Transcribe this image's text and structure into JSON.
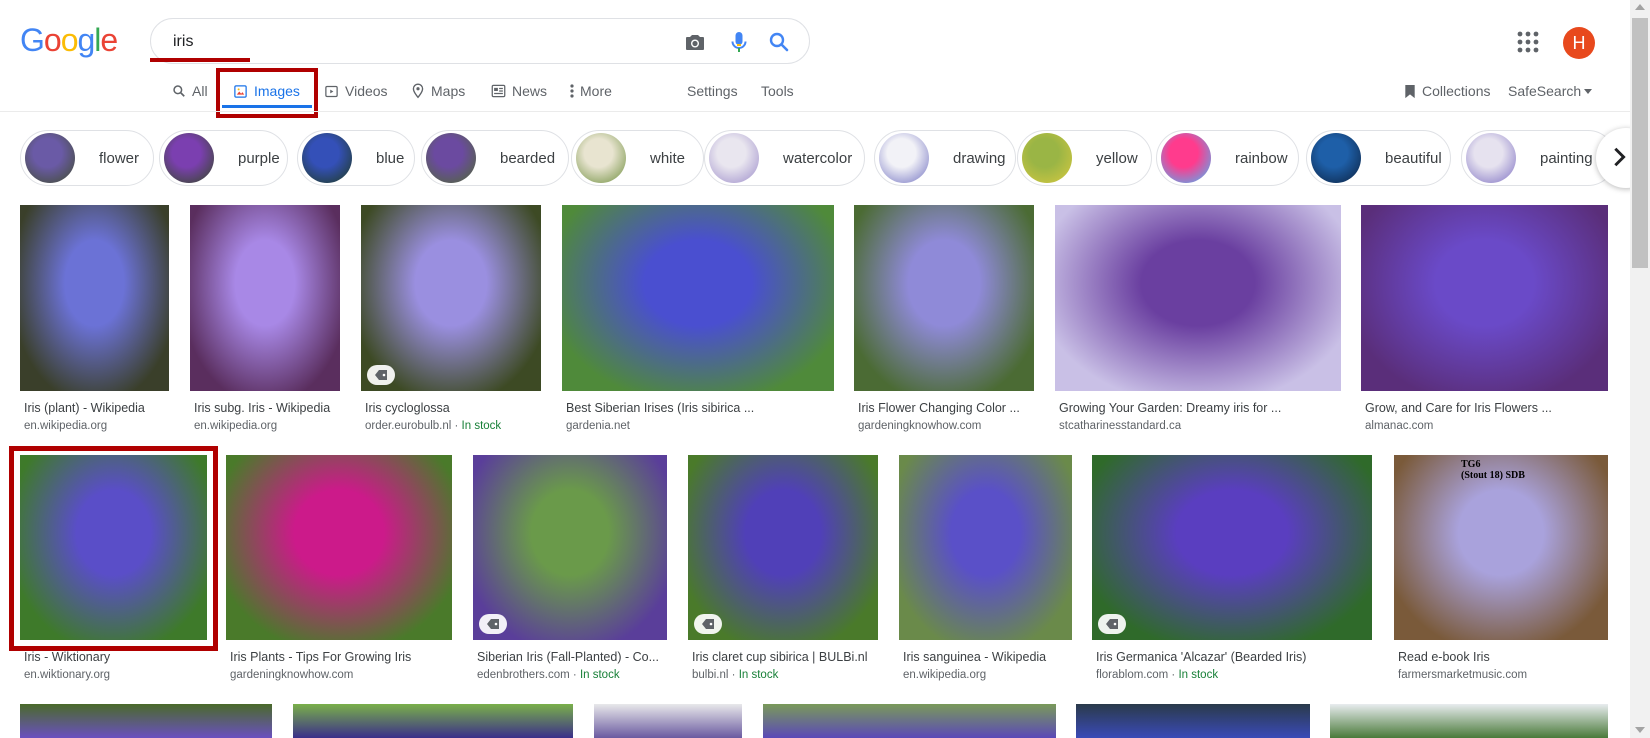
{
  "search": {
    "query": "iris"
  },
  "nav": {
    "all": "All",
    "images": "Images",
    "videos": "Videos",
    "maps": "Maps",
    "news": "News",
    "more": "More",
    "settings": "Settings",
    "tools": "Tools",
    "collections": "Collections",
    "safesearch": "SafeSearch"
  },
  "user": {
    "initial": "H"
  },
  "chips": [
    "flower",
    "purple",
    "blue",
    "bearded",
    "white",
    "watercolor",
    "drawing",
    "yellow",
    "rainbow",
    "beautiful",
    "painting"
  ],
  "results": {
    "row1": [
      {
        "title": "Iris (plant) - Wikipedia",
        "source": "en.wikipedia.org"
      },
      {
        "title": "Iris subg. Iris - Wikipedia",
        "source": "en.wikipedia.org"
      },
      {
        "title": "Iris cycloglossa",
        "source": "order.eurobulb.nl",
        "stock": "In stock"
      },
      {
        "title": "Best Siberian Irises (Iris sibirica ...",
        "source": "gardenia.net"
      },
      {
        "title": "Iris Flower Changing Color ...",
        "source": "gardeningknowhow.com"
      },
      {
        "title": "Growing Your Garden: Dreamy iris for ...",
        "source": "stcatharinesstandard.ca"
      },
      {
        "title": "Grow, and Care for Iris Flowers ...",
        "source": "almanac.com"
      }
    ],
    "row2": [
      {
        "title": "Iris - Wiktionary",
        "source": "en.wiktionary.org"
      },
      {
        "title": "Iris Plants - Tips For Growing Iris",
        "source": "gardeningknowhow.com"
      },
      {
        "title": "Siberian Iris (Fall-Planted) - Co...",
        "source": "edenbrothers.com",
        "stock": "In stock"
      },
      {
        "title": "Iris claret cup sibirica | BULBi.nl",
        "source": "bulbi.nl",
        "stock": "In stock"
      },
      {
        "title": "Iris sanguinea - Wikipedia",
        "source": "en.wikipedia.org"
      },
      {
        "title": "Iris Germanica 'Alcazar' (Bearded Iris)",
        "source": "florablom.com",
        "stock": "In stock"
      },
      {
        "title": "Read e-book Iris",
        "source": "farmersmarketmusic.com",
        "image_text": "TG6\n(Stout 18) SDB"
      }
    ]
  },
  "colors": {
    "accent": "#1a73e8",
    "annotation": "#b00000",
    "avatar": "#e8491d",
    "stock": "#188038"
  }
}
